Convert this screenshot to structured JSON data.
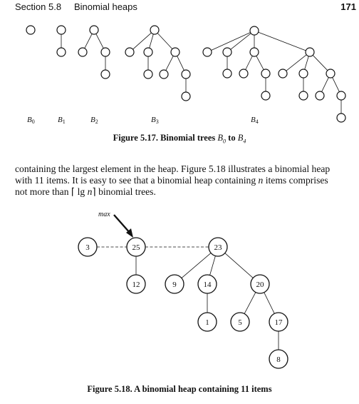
{
  "header": {
    "section": "Section 5.8",
    "title": "Binomial heaps",
    "page_number": "171"
  },
  "figure_5_17": {
    "caption_prefix": "Figure 5.17. Binomial trees ",
    "caption_b0": "B",
    "caption_b0_sub": "0",
    "caption_to": " to ",
    "caption_b4": "B",
    "caption_b4_sub": "4",
    "trees": [
      {
        "label": "B",
        "sub": "0"
      },
      {
        "label": "B",
        "sub": "1"
      },
      {
        "label": "B",
        "sub": "2"
      },
      {
        "label": "B",
        "sub": "3"
      },
      {
        "label": "B",
        "sub": "4"
      }
    ]
  },
  "paragraph": {
    "line1": "containing the largest element in the heap. Figure 5.18 illustrates a binomial heap",
    "line2_a": "with 11 items. It is easy to see that a binomial heap containing ",
    "line2_n": "n",
    "line2_b": " items comprises",
    "line3_a": "not more than ⌈ lg ",
    "line3_n": "n",
    "line3_b": "⌉ binomial trees."
  },
  "figure_5_18": {
    "caption": "Figure 5.18. A binomial heap containing 11 items",
    "max_label": "max",
    "nodes": [
      "3",
      "25",
      "23",
      "12",
      "9",
      "14",
      "20",
      "1",
      "5",
      "17",
      "8"
    ]
  }
}
